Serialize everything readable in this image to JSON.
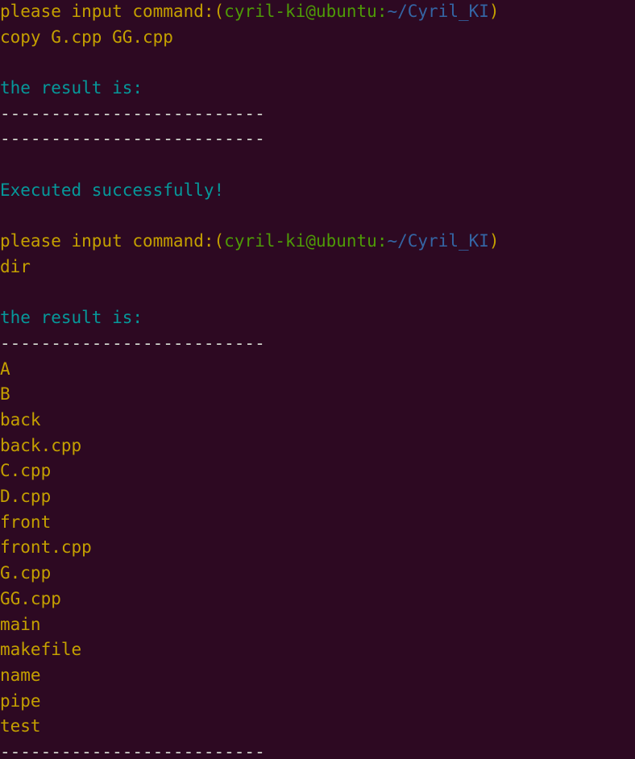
{
  "terminal": {
    "background_color": "#2d0922",
    "colors": {
      "prompt": "#c4a000",
      "user_host": "#4e9a06",
      "path": "#3465a4",
      "command": "#c4a000",
      "label": "#06989a",
      "rule": "#d3d7cf",
      "filename": "#c4a000",
      "success": "#06989a"
    },
    "prompt_prefix": "please input command:",
    "paren_open": "(",
    "paren_close": ")",
    "user_host": "cyril-ki@ubuntu:",
    "path": "~/Cyril_KI",
    "result_label": "the result is:",
    "separator": "--------------------------",
    "success_message": "Executed successfully!",
    "commands": {
      "copy": "copy G.cpp GG.cpp",
      "dir": "dir"
    },
    "directory_listing": [
      "A",
      "B",
      "back",
      "back.cpp",
      "C.cpp",
      "D.cpp",
      "front",
      "front.cpp",
      "G.cpp",
      "GG.cpp",
      "main",
      "makefile",
      "name",
      "pipe",
      "test"
    ]
  }
}
